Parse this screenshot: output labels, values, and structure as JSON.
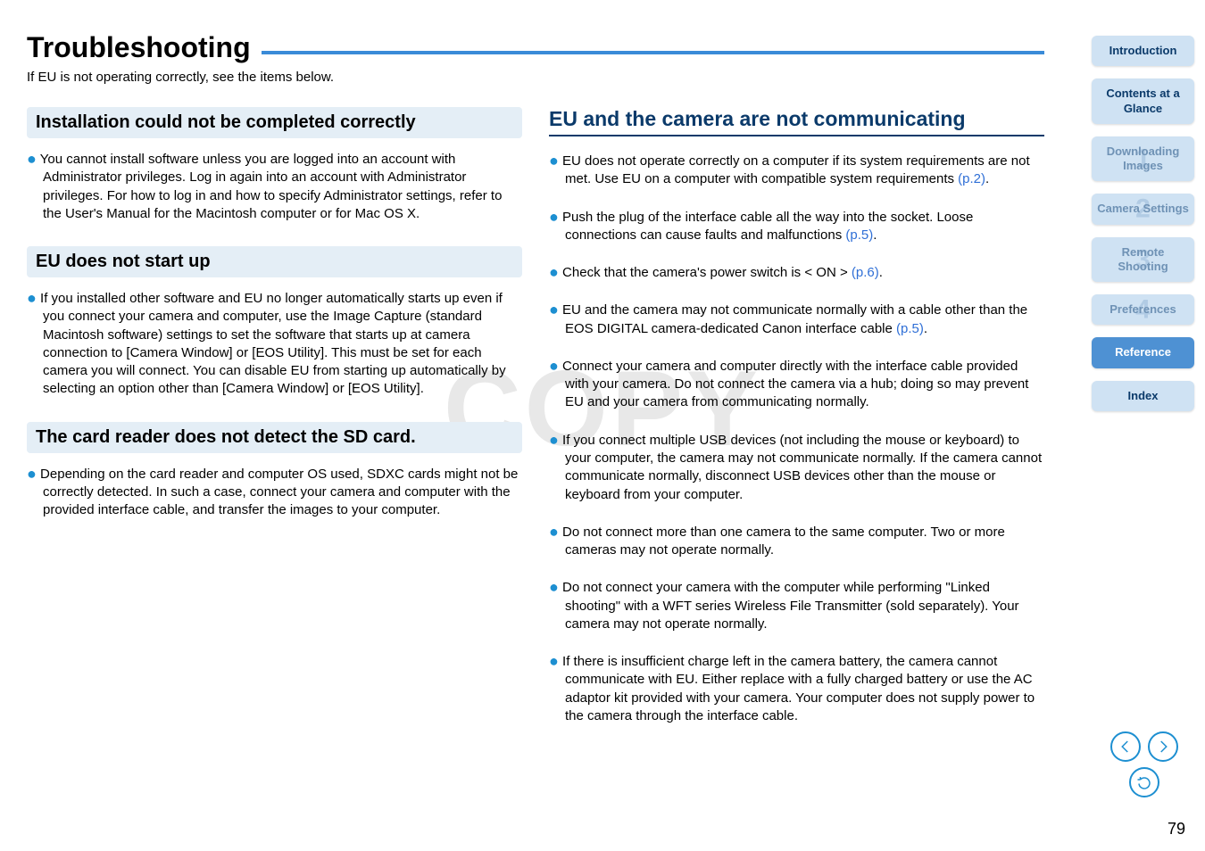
{
  "title": "Troubleshooting",
  "intro": "If EU is not operating correctly, see the items below.",
  "watermark": "COPY",
  "left": {
    "install": {
      "heading": "Installation could not be completed correctly",
      "text": "You cannot install software unless you are logged into an account with Administrator privileges. Log in again into an account with Administrator privileges.\nFor how to log in and how to specify Administrator settings, refer to the User's Manual for the Macintosh computer or for Mac OS X."
    },
    "start": {
      "heading": "EU does not start up",
      "text": "If you installed other software and EU no longer automatically starts up even if you connect your camera and computer, use the Image Capture (standard Macintosh software) settings to set the software that starts up at camera connection to [Camera Window] or [EOS Utility]. This must be set for each camera you will connect. You can disable EU from starting up automatically by selecting an option other than [Camera Window] or [EOS Utility]."
    },
    "card": {
      "heading": "The card reader does not detect the SD card.",
      "text": "Depending on the card reader and computer OS used, SDXC cards might not be correctly detected. In such a case, connect your camera and computer with the provided interface cable, and transfer the images to your computer."
    }
  },
  "right": {
    "heading": "EU and the camera are not communicating",
    "items": [
      {
        "t": "EU does not operate correctly on a computer if its system requirements are not met. Use EU on a computer with compatible system requirements ",
        "link": "(p.2)",
        "tail": "."
      },
      {
        "t": "Push the plug of the interface cable all the way into the socket. Loose connections can cause faults and malfunctions ",
        "link": "(p.5)",
        "tail": "."
      },
      {
        "t": "Check that the camera's power switch is < ON > ",
        "link": "(p.6)",
        "tail": "."
      },
      {
        "t": "EU and the camera may not communicate normally with a cable other than the EOS DIGITAL camera-dedicated Canon interface cable ",
        "link": "(p.5)",
        "tail": "."
      },
      {
        "t": "Connect your camera and computer directly with the interface cable provided with your camera. Do not connect the camera via a hub; doing so may prevent EU and your camera from communicating normally."
      },
      {
        "t": "If you connect multiple USB devices (not including the mouse or keyboard) to your computer, the camera may not communicate normally. If the camera cannot communicate normally, disconnect USB devices other than the mouse or keyboard from your computer."
      },
      {
        "t": "Do not connect more than one camera to the same computer. Two or more cameras may not operate normally."
      },
      {
        "t": "Do not connect your camera with the computer while performing \"Linked shooting\" with a WFT series Wireless File Transmitter (sold separately). Your camera may not operate normally."
      },
      {
        "t": "If there is insufficient charge left in the camera battery, the camera cannot communicate with EU. Either replace with a fully charged battery or use the AC adaptor kit provided with your camera. Your computer does not supply power to the camera through the interface cable."
      }
    ]
  },
  "nav": [
    {
      "label": "Introduction",
      "num": ""
    },
    {
      "label": "Contents at a Glance",
      "num": ""
    },
    {
      "label": "Downloading Images",
      "num": "1"
    },
    {
      "label": "Camera Settings",
      "num": "2"
    },
    {
      "label": "Remote Shooting",
      "num": "3"
    },
    {
      "label": "Preferences",
      "num": "4"
    },
    {
      "label": "Reference",
      "num": "",
      "active": true
    },
    {
      "label": "Index",
      "num": ""
    }
  ],
  "pageNum": "79"
}
